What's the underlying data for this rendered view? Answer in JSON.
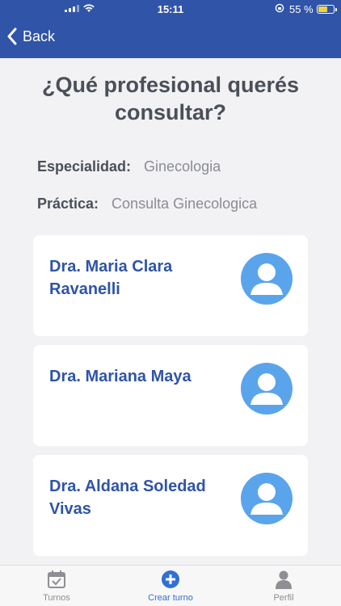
{
  "status_bar": {
    "time": "15:11",
    "battery": "55 %"
  },
  "nav": {
    "back_label": "Back"
  },
  "page": {
    "title": "¿Qué profesional querés consultar?"
  },
  "info": {
    "specialty_label": "Especialidad:",
    "specialty_value": "Ginecologia",
    "practice_label": "Práctica:",
    "practice_value": "Consulta Ginecologica"
  },
  "doctors": [
    {
      "name": "Dra. Maria Clara Ravanelli"
    },
    {
      "name": "Dra. Mariana Maya"
    },
    {
      "name": "Dra. Aldana Soledad Vivas"
    }
  ],
  "tabs": [
    {
      "label": "Turnos",
      "icon": "calendar-check-icon"
    },
    {
      "label": "Crear turno",
      "icon": "plus-circle-icon",
      "active": true
    },
    {
      "label": "Perfil",
      "icon": "person-icon"
    }
  ],
  "colors": {
    "primary": "#2f54a8",
    "active_tab": "#2f6fd6",
    "avatar": "#5aa4ec",
    "battery": "#f5d23c"
  }
}
